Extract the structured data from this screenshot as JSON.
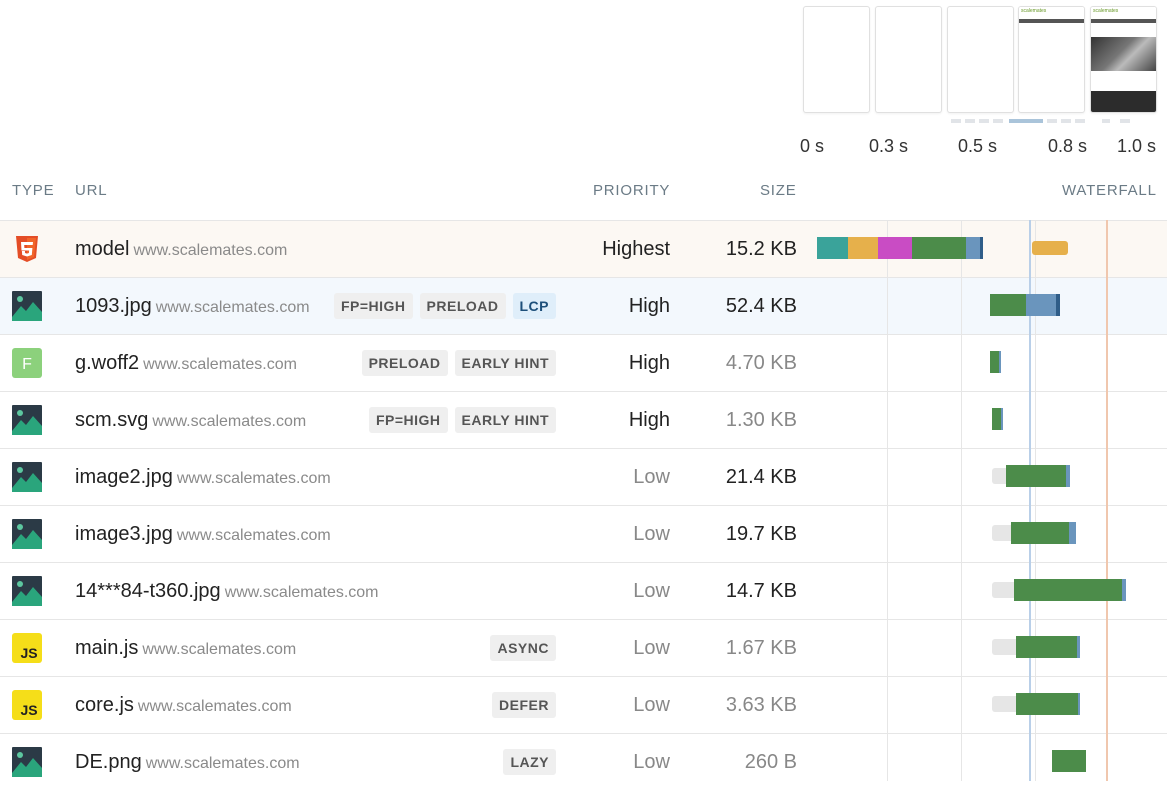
{
  "filmstrip": {
    "time_labels": [
      "0 s",
      "0.3 s",
      "0.5 s",
      "0.8 s",
      "1.0 s"
    ],
    "screenshot_site": "scalemates"
  },
  "table": {
    "headers": {
      "type": "TYPE",
      "url": "URL",
      "priority": "PRIORITY",
      "size": "SIZE",
      "waterfall": "WATERFALL"
    },
    "rows": [
      {
        "type": "html",
        "type_icon": "html5-icon",
        "name": "model",
        "host": "www.scalemates.com",
        "badges": [],
        "priority": "Highest",
        "size": "15.2 KB"
      },
      {
        "type": "image",
        "type_icon": "image-icon",
        "name": "1093.jpg",
        "host": "www.scalemates.com",
        "badges": [
          "FP=HIGH",
          "PRELOAD",
          "LCP"
        ],
        "priority": "High",
        "size": "52.4 KB"
      },
      {
        "type": "font",
        "type_icon": "font-icon",
        "type_letter": "F",
        "name": "g.woff2",
        "host": "www.scalemates.com",
        "badges": [
          "PRELOAD",
          "EARLY HINT"
        ],
        "priority": "High",
        "size": "4.70 KB"
      },
      {
        "type": "image",
        "type_icon": "image-icon",
        "name": "scm.svg",
        "host": "www.scalemates.com",
        "badges": [
          "FP=HIGH",
          "EARLY HINT"
        ],
        "priority": "High",
        "size": "1.30 KB"
      },
      {
        "type": "image",
        "type_icon": "image-icon",
        "name": "image2.jpg",
        "host": "www.scalemates.com",
        "badges": [],
        "priority": "Low",
        "size": "21.4 KB"
      },
      {
        "type": "image",
        "type_icon": "image-icon",
        "name": "image3.jpg",
        "host": "www.scalemates.com",
        "badges": [],
        "priority": "Low",
        "size": "19.7 KB"
      },
      {
        "type": "image",
        "type_icon": "image-icon",
        "name": "14***84-t360.jpg",
        "host": "www.scalemates.com",
        "badges": [],
        "priority": "Low",
        "size": "14.7 KB"
      },
      {
        "type": "js",
        "type_icon": "js-icon",
        "type_letter": "JS",
        "name": "main.js",
        "host": "www.scalemates.com",
        "badges": [
          "ASYNC"
        ],
        "priority": "Low",
        "size": "1.67 KB"
      },
      {
        "type": "js",
        "type_icon": "js-icon",
        "type_letter": "JS",
        "name": "core.js",
        "host": "www.scalemates.com",
        "badges": [
          "DEFER"
        ],
        "priority": "Low",
        "size": "3.63 KB"
      },
      {
        "type": "image",
        "type_icon": "image-icon",
        "name": "DE.png",
        "host": "www.scalemates.com",
        "badges": [
          "LAZY"
        ],
        "priority": "Low",
        "size": "260 B"
      }
    ]
  },
  "colors": {
    "dns": "#3aa39a",
    "connect": "#e6b04b",
    "ssl": "#c94cc4",
    "download": "#4c8c4a",
    "wait": "#6a95bd",
    "queued": "#e6e6e6",
    "lcp_line": "#b9cfe8",
    "load_line": "#f0c7ae",
    "html_icon": "#e44d26",
    "font_icon": "#8cd17c",
    "js_icon": "#f5de19"
  }
}
